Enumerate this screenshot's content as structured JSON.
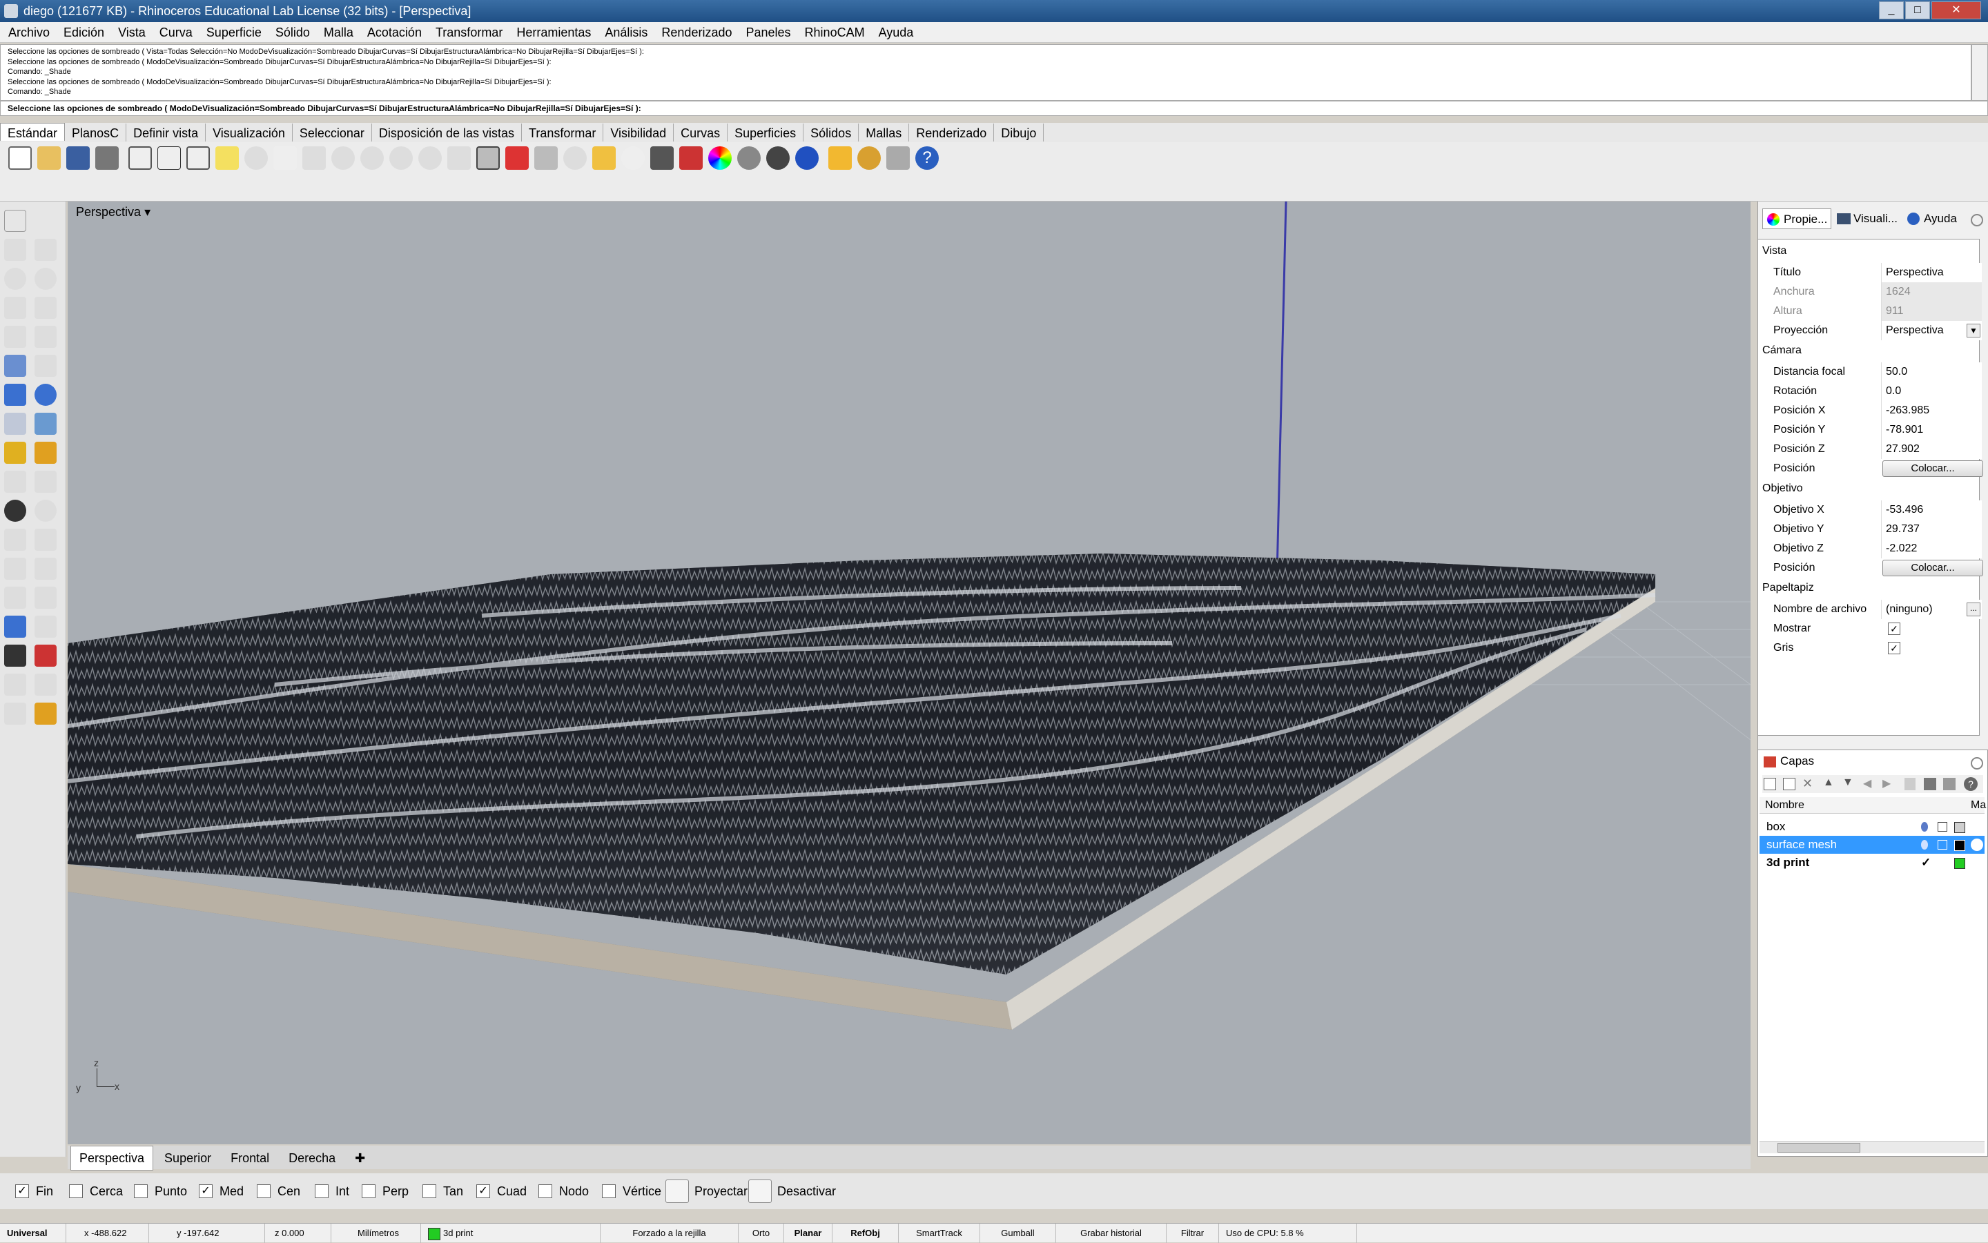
{
  "window": {
    "title": "diego (121677 KB) - Rhinoceros Educational Lab License (32 bits) - [Perspectiva]"
  },
  "menu": [
    "Archivo",
    "Edición",
    "Vista",
    "Curva",
    "Superficie",
    "Sólido",
    "Malla",
    "Acotación",
    "Transformar",
    "Herramientas",
    "Análisis",
    "Renderizado",
    "Paneles",
    "RhinoCAM",
    "Ayuda"
  ],
  "command": {
    "history": [
      "Seleccione las opciones de sombreado ( Vista=Todas  Selección=No  ModoDeVisualización=Sombreado  DibujarCurvas=Sí  DibujarEstructuraAlámbrica=No  DibujarRejilla=Sí  DibujarEjes=Sí ):",
      "Seleccione las opciones de sombreado ( ModoDeVisualización=Sombreado  DibujarCurvas=Sí  DibujarEstructuraAlámbrica=No  DibujarRejilla=Sí  DibujarEjes=Sí ):",
      "Comando: _Shade",
      "Seleccione las opciones de sombreado ( ModoDeVisualización=Sombreado  DibujarCurvas=Sí  DibujarEstructuraAlámbrica=No  DibujarRejilla=Sí  DibujarEjes=Sí ):",
      "Comando: _Shade"
    ],
    "prompt": "Seleccione las opciones de sombreado ( ModoDeVisualización=Sombreado  DibujarCurvas=Sí  DibujarEstructuraAlámbrica=No  DibujarRejilla=Sí  DibujarEjes=Sí ):"
  },
  "toolbar_tabs": [
    "Estándar",
    "PlanosC",
    "Definir vista",
    "Visualización",
    "Seleccionar",
    "Disposición de las vistas",
    "Transformar",
    "Visibilidad",
    "Curvas",
    "Superficies",
    "Sólidos",
    "Mallas",
    "Renderizado",
    "Dibujo"
  ],
  "viewport": {
    "title": "Perspectiva",
    "axis": {
      "z": "z",
      "y": "y",
      "x": "x"
    }
  },
  "viewport_tabs": [
    "Perspectiva",
    "Superior",
    "Frontal",
    "Derecha"
  ],
  "osnap": {
    "items": [
      {
        "label": "Fin",
        "checked": true
      },
      {
        "label": "Cerca",
        "checked": false
      },
      {
        "label": "Punto",
        "checked": false
      },
      {
        "label": "Med",
        "checked": true
      },
      {
        "label": "Cen",
        "checked": false
      },
      {
        "label": "Int",
        "checked": false
      },
      {
        "label": "Perp",
        "checked": false
      },
      {
        "label": "Tan",
        "checked": false
      },
      {
        "label": "Cuad",
        "checked": true
      },
      {
        "label": "Nodo",
        "checked": false
      },
      {
        "label": "Vértice",
        "checked": false
      }
    ],
    "proyectar": "Proyectar",
    "desactivar": "Desactivar",
    "check": "✓"
  },
  "status": {
    "cplane": "Universal",
    "x": "x -488.622",
    "y": "y -197.642",
    "z": "z 0.000",
    "units": "Milímetros",
    "layer": "3d print",
    "grid": "Forzado a la rejilla",
    "orto": "Orto",
    "planar": "Planar",
    "refobj": "RefObj",
    "smarttrack": "SmartTrack",
    "gumball": "Gumball",
    "history": "Grabar historial",
    "filter": "Filtrar",
    "cpu": "Uso de CPU: 5.8 %"
  },
  "panel_tabs": [
    "Propie...",
    "Visuali...",
    "Ayuda"
  ],
  "properties": {
    "vista": "Vista",
    "titulo_label": "Título",
    "titulo": "Perspectiva",
    "anchura_label": "Anchura",
    "anchura": "1624",
    "altura_label": "Altura",
    "altura": "911",
    "proyeccion_label": "Proyección",
    "proyeccion": "Perspectiva",
    "camara": "Cámara",
    "focal_label": "Distancia focal",
    "focal": "50.0",
    "rot_label": "Rotación",
    "rot": "0.0",
    "px_label": "Posición X",
    "px": "-263.985",
    "py_label": "Posición Y",
    "py": "-78.901",
    "pz_label": "Posición Z",
    "pz": "27.902",
    "pos_label": "Posición",
    "colocar": "Colocar...",
    "objetivo": "Objetivo",
    "ox_label": "Objetivo X",
    "ox": "-53.496",
    "oy_label": "Objetivo Y",
    "oy": "29.737",
    "oz_label": "Objetivo Z",
    "oz": "-2.022",
    "papeltapiz": "Papeltapiz",
    "archivo_label": "Nombre de archivo",
    "archivo": "(ninguno)",
    "mostrar_label": "Mostrar",
    "gris_label": "Gris",
    "more": "..."
  },
  "layers": {
    "title": "Capas",
    "col_name": "Nombre",
    "col_mat": "Ma",
    "rows": [
      {
        "name": "box",
        "color": "#d0d0d0"
      },
      {
        "name": "surface mesh",
        "color": "#000000"
      },
      {
        "name": "3d print",
        "color": "#22cc22"
      }
    ]
  }
}
